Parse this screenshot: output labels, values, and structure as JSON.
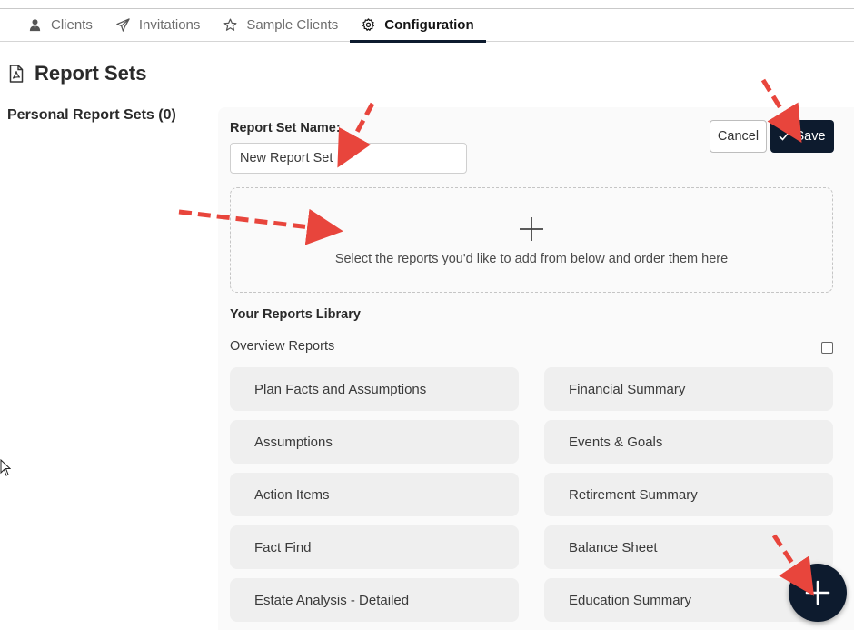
{
  "tabs": [
    {
      "label": "Clients",
      "icon": "user-tie-icon"
    },
    {
      "label": "Invitations",
      "icon": "paper-plane-icon"
    },
    {
      "label": "Sample Clients",
      "icon": "star-icon"
    },
    {
      "label": "Configuration",
      "icon": "gear-icon",
      "active": true
    }
  ],
  "page": {
    "title": "Report Sets",
    "title_icon": "pdf-file-icon",
    "personal_sets_label": "Personal Report Sets (0)"
  },
  "editor": {
    "name_label": "Report Set Name:",
    "name_value": "New Report Set",
    "cancel_label": "Cancel",
    "save_label": "Save",
    "save_icon": "checkmark-icon",
    "dropzone_hint": "Select the reports you'd like to add from below and order them here"
  },
  "library": {
    "title": "Your Reports Library",
    "category": "Overview Reports",
    "category_checked": false,
    "reports_left": [
      "Plan Facts and Assumptions",
      "Assumptions",
      "Action Items",
      "Fact Find",
      "Estate Analysis - Detailed"
    ],
    "reports_right": [
      "Financial Summary",
      "Events & Goals",
      "Retirement Summary",
      "Balance Sheet",
      "Education Summary"
    ]
  },
  "colors": {
    "primary": "#0d1b2e",
    "annotation_arrow": "#e8453c",
    "card_bg": "#efefef"
  }
}
